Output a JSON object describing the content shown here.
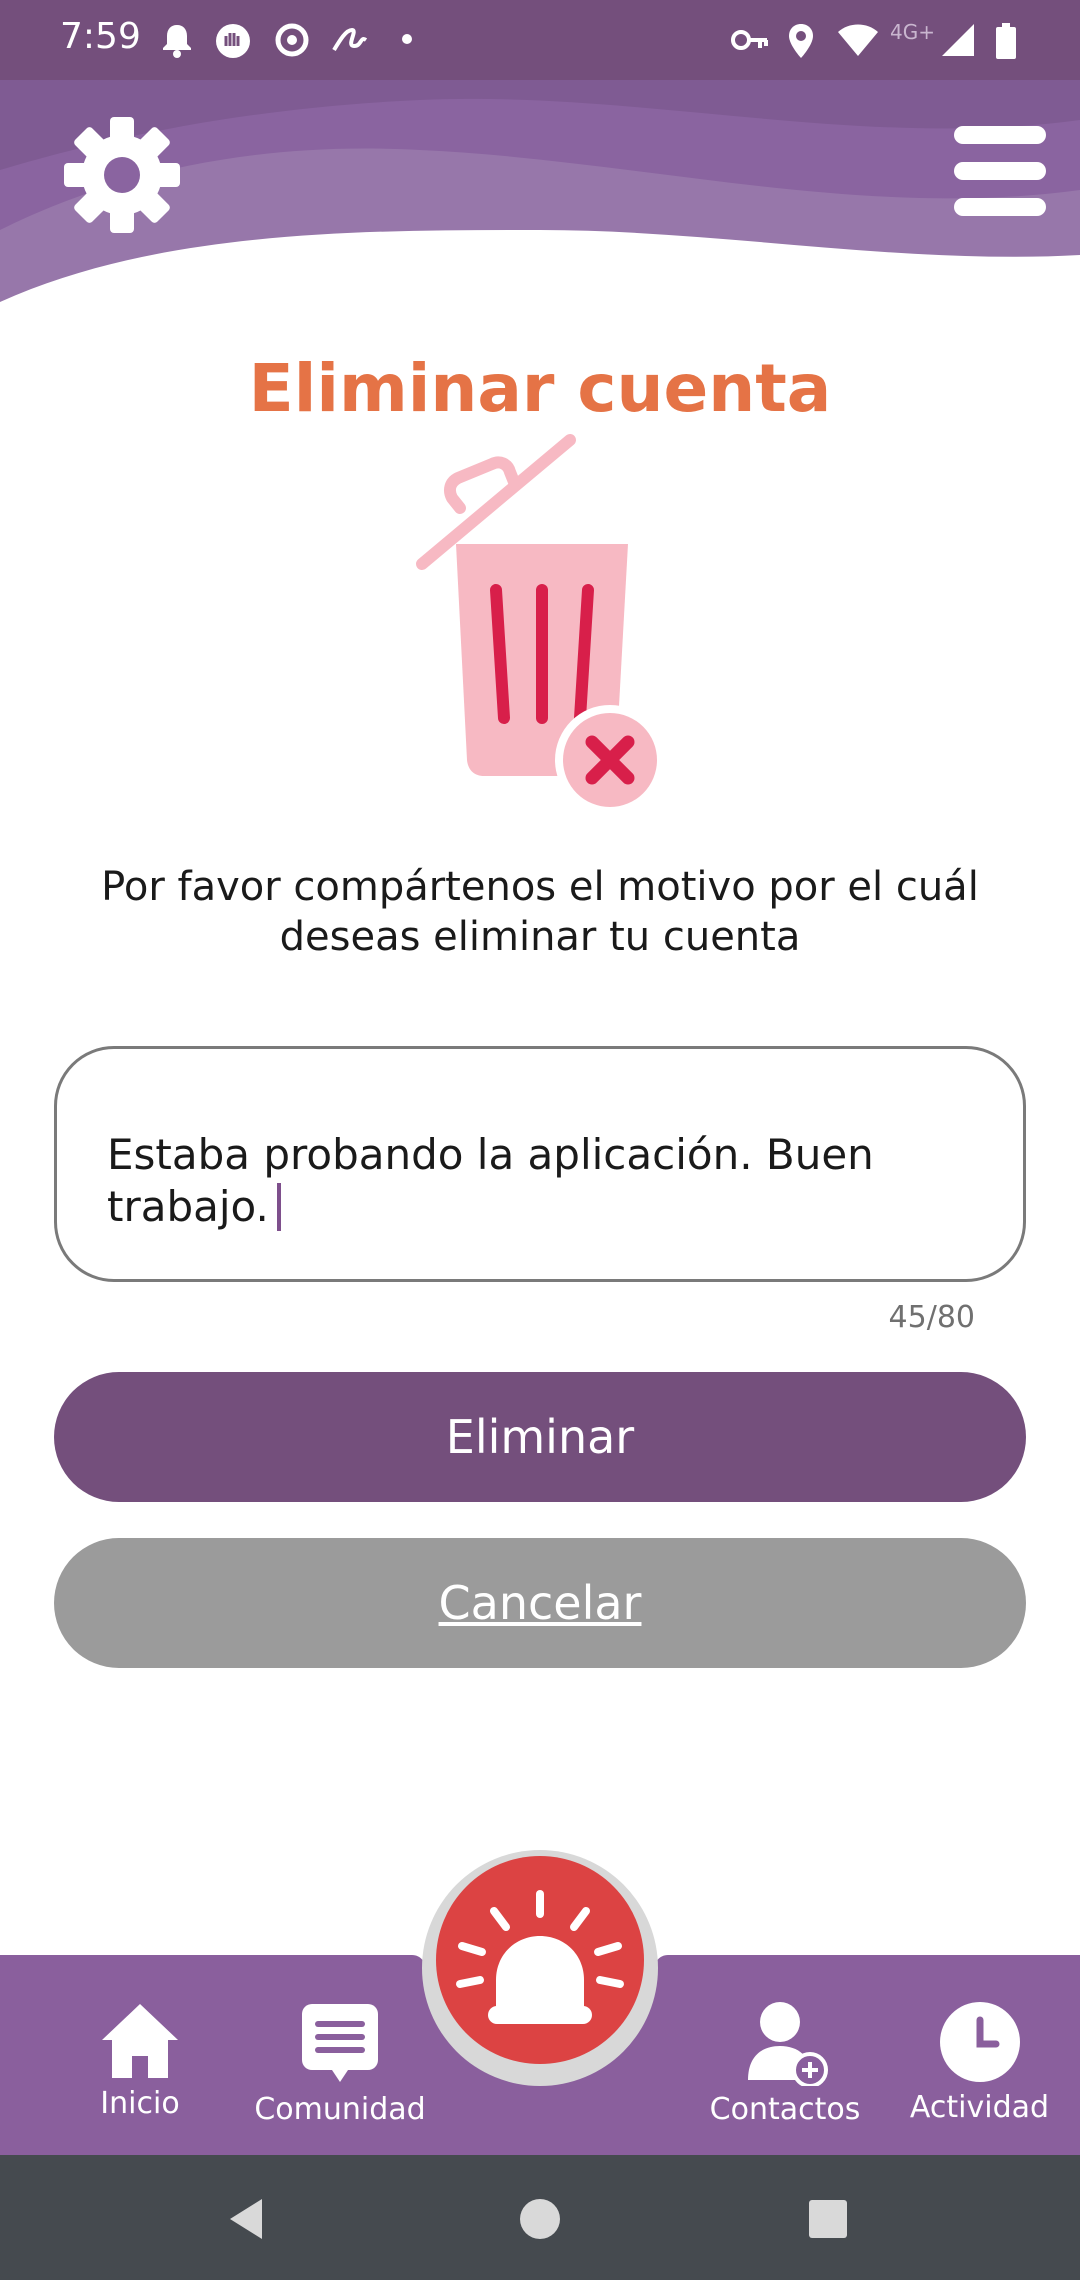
{
  "status_bar": {
    "time": "7:59",
    "network": "4G+",
    "left_icons": [
      "bell-icon",
      "hand-icon",
      "ring-icon",
      "scribble-icon",
      "dot-icon"
    ],
    "right_icons": [
      "vpn-key-icon",
      "location-pin-icon",
      "wifi-icon",
      "signal-icon",
      "battery-icon"
    ]
  },
  "header": {
    "settings_icon": "gear-icon",
    "menu_icon": "hamburger-menu-icon"
  },
  "page": {
    "title": "Eliminar cuenta",
    "illustration": "trash-can-delete-icon",
    "prompt": "Por favor compártenos el motivo por el cuál deseas eliminar tu cuenta",
    "reason_value": "Estaba probando la aplicación. Buen trabajo.",
    "char_counter": "45/80"
  },
  "buttons": {
    "delete_label": "Eliminar",
    "cancel_label": "Cancelar"
  },
  "bottom_nav": {
    "items": [
      {
        "label": "Inicio",
        "icon": "home-icon"
      },
      {
        "label": "Comunidad",
        "icon": "chat-bubble-icon"
      },
      {
        "label": "Contactos",
        "icon": "add-contact-icon"
      },
      {
        "label": "Actividad",
        "icon": "clock-icon"
      }
    ],
    "sos_icon": "alarm-siren-icon"
  },
  "colors": {
    "primary": "#744f7c",
    "nav_background": "#8a5f9d",
    "title_orange": "#e57346",
    "cancel_gray": "#9b9b9b",
    "sos_red": "#dc4343",
    "trash_pink": "#f7b9c3",
    "trash_red": "#d81f4a"
  }
}
